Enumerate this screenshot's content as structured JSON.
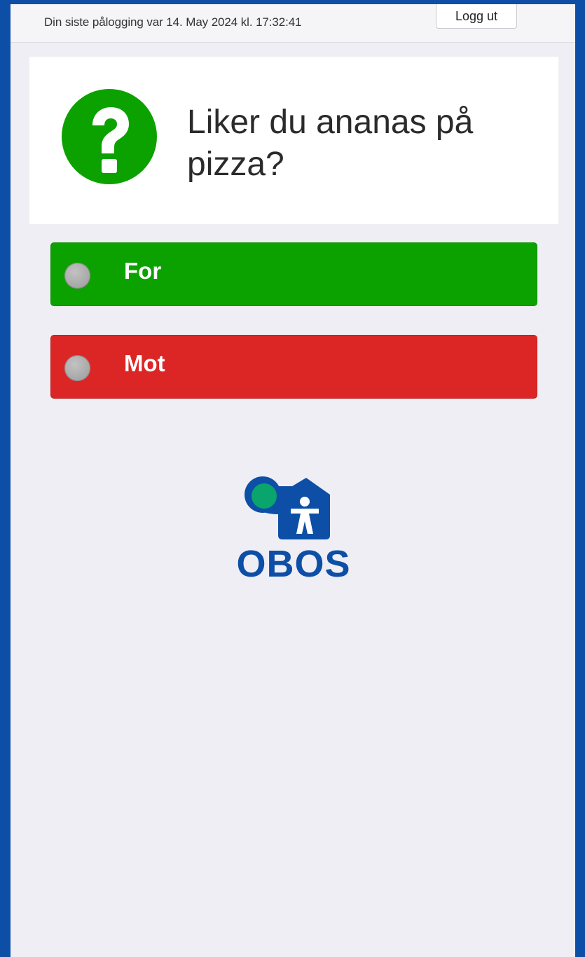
{
  "header": {
    "last_login": "Din siste pålogging var 14. May 2024 kl. 17:32:41",
    "logout_label": "Logg ut"
  },
  "question": {
    "icon": "question-mark-icon",
    "text": "Liker du ananas på pizza?"
  },
  "options": [
    {
      "label": "For",
      "color": "#0ba200",
      "selected": false
    },
    {
      "label": "Mot",
      "color": "#dc2626",
      "selected": false
    }
  ],
  "logo": {
    "text": "OBOS",
    "icon": "obos-house-person-icon",
    "brand_color": "#0d4fa7",
    "accent_color": "#0aa46d"
  },
  "colors": {
    "frame_border": "#0d4fa7",
    "background": "#efeef4"
  }
}
